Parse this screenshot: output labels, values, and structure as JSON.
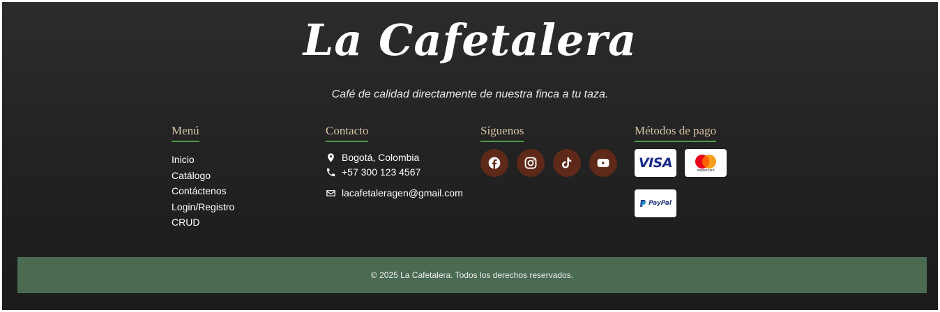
{
  "brand": {
    "name": "La Cafetalera",
    "tagline": "Café de calidad directamente de nuestra finca a tu taza."
  },
  "menu": {
    "title": "Menú",
    "items": [
      "Inicio",
      "Catálogo",
      "Contáctenos",
      "Login/Registro",
      "CRUD"
    ]
  },
  "contact": {
    "title": "Contacto",
    "location": "Bogotá, Colombia",
    "phone": "+57 300 123 4567",
    "email": "lacafetaleragen@gmail.com"
  },
  "social": {
    "title": "Síguenos",
    "icons": [
      "facebook-icon",
      "instagram-icon",
      "tiktok-icon",
      "youtube-icon"
    ]
  },
  "payments": {
    "title": "Métodos de pago",
    "visa": "VISA",
    "mastercard": "mastercard",
    "paypal": "PayPal"
  },
  "footer": {
    "copyright": "© 2025 La Cafetalera. Todos los derechos reservados."
  },
  "colors": {
    "background": "#232323",
    "heading": "#d6c3a3",
    "underline": "#4a9e44",
    "social_bg": "#5e2918",
    "bottom_bar": "#4a6a52"
  }
}
